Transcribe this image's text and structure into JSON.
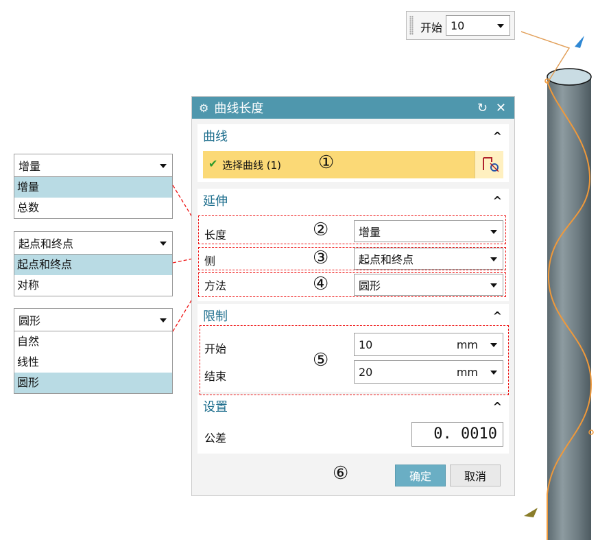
{
  "top_widget": {
    "label": "开始",
    "value": "10"
  },
  "dialog": {
    "title": "曲线长度",
    "sections": {
      "curve": {
        "title": "曲线",
        "select_label": "选择曲线 (1)",
        "marker": "①"
      },
      "extend": {
        "title": "延伸",
        "rows": [
          {
            "label": "长度",
            "value": "增量",
            "marker": "②"
          },
          {
            "label": "侧",
            "value": "起点和终点",
            "marker": "③"
          },
          {
            "label": "方法",
            "value": "圆形",
            "marker": "④"
          }
        ]
      },
      "limits": {
        "title": "限制",
        "start_label": "开始",
        "start_value": "10",
        "start_unit": "mm",
        "end_label": "结束",
        "end_value": "20",
        "end_unit": "mm",
        "marker": "⑤"
      },
      "settings": {
        "title": "设置",
        "tolerance_label": "公差",
        "tolerance_value": "0. 0010"
      }
    },
    "footer": {
      "marker": "⑥",
      "ok_label": "确定",
      "cancel_label": "取消"
    }
  },
  "dropdowns": {
    "length": {
      "selected": "增量",
      "options": [
        "增量",
        "总数"
      ]
    },
    "side": {
      "selected": "起点和终点",
      "options": [
        "起点和终点",
        "对称"
      ]
    },
    "method": {
      "selected": "圆形",
      "options": [
        "自然",
        "线性",
        "圆形"
      ]
    }
  },
  "colors": {
    "title_bar": "#4f97ad",
    "section_title": "#1f6f8e",
    "selection_highlight": "#fbd976",
    "option_selected": "#b9dbe4",
    "annotation": "#ee1111",
    "ok_button": "#6aaec4",
    "cylinder": "#7b8a90",
    "helix": "#f0993a"
  }
}
